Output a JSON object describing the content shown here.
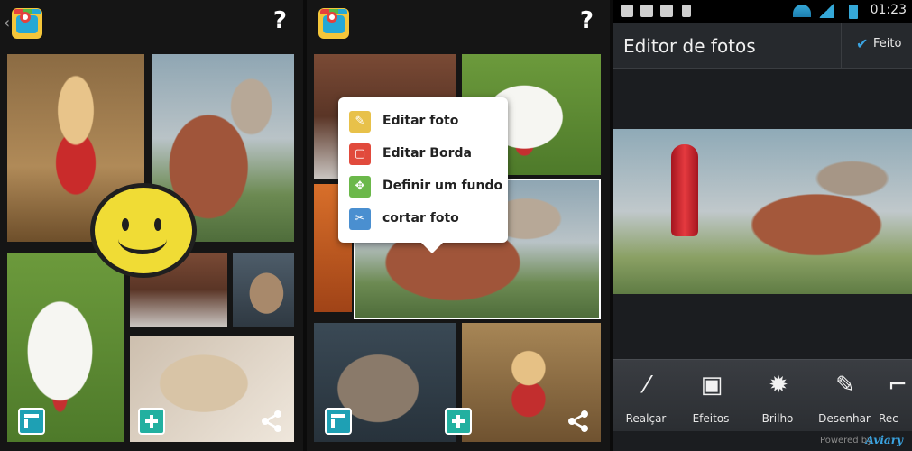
{
  "panel2": {
    "menu": [
      {
        "label": "Editar foto",
        "icon": "edit-photo-icon",
        "color": "#e8c14a"
      },
      {
        "label": "Editar Borda",
        "icon": "edit-border-icon",
        "color": "#e14a3c"
      },
      {
        "label": "Definir um fundo",
        "icon": "background-icon",
        "color": "#6bb84a"
      },
      {
        "label": "cortar foto",
        "icon": "scissors-icon",
        "color": "#4a8fd0"
      }
    ]
  },
  "editor": {
    "status_time": "01:23",
    "title": "Editor de fotos",
    "done_label": "Feito",
    "tools": [
      {
        "label": "Realçar",
        "icon": "magic-wand-icon"
      },
      {
        "label": "Efeitos",
        "icon": "film-icon"
      },
      {
        "label": "Brilho",
        "icon": "sun-icon"
      },
      {
        "label": "Desenhar",
        "icon": "pencil-icon"
      },
      {
        "label": "Rec",
        "icon": "crop-icon"
      }
    ],
    "powered_by": "Powered by",
    "brand": "Aviary"
  }
}
